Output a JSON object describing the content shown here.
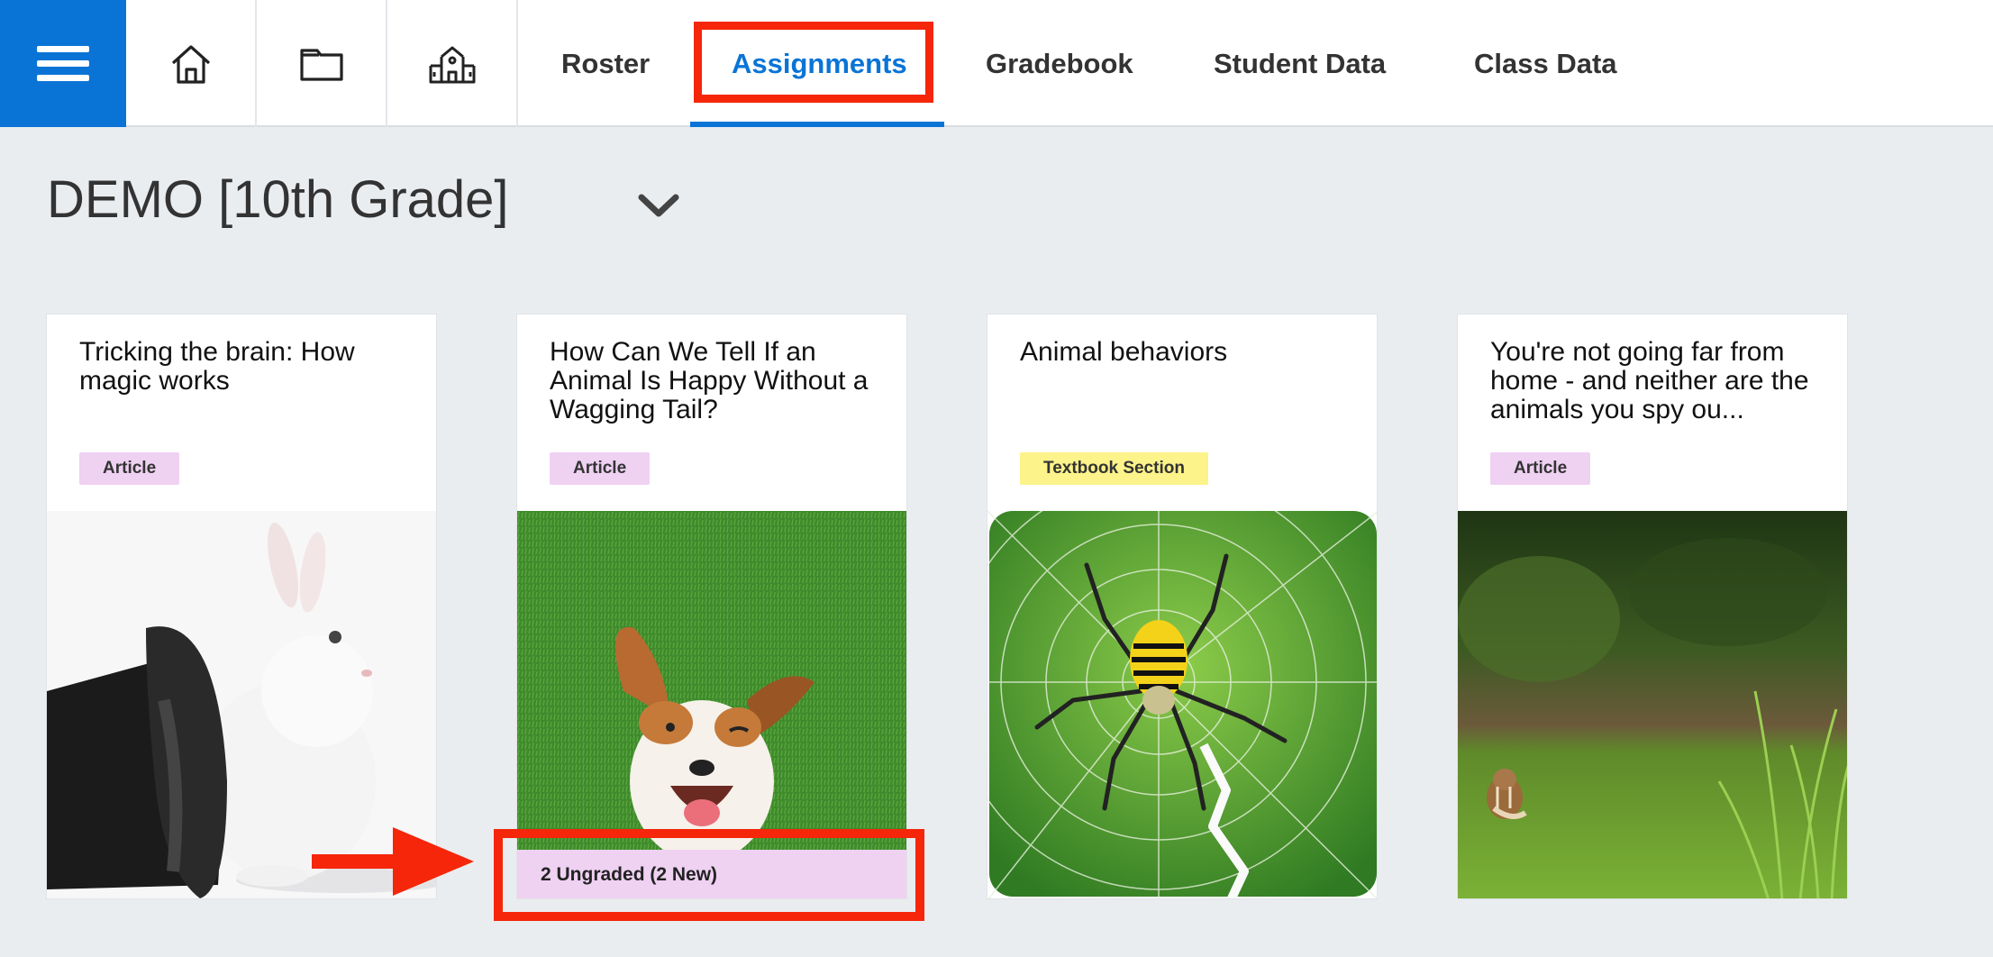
{
  "nav": {
    "menu_icon": "hamburger-icon",
    "icons": [
      "home-icon",
      "folder-icon",
      "school-icon"
    ],
    "tabs": [
      {
        "label": "Roster",
        "active": false
      },
      {
        "label": "Assignments",
        "active": true
      },
      {
        "label": "Gradebook",
        "active": false
      },
      {
        "label": "Student Data",
        "active": false
      },
      {
        "label": "Class Data",
        "active": false
      }
    ],
    "accent_color": "#0a74d6",
    "highlight_color": "#f5260a"
  },
  "class_selector": {
    "title": "DEMO [10th Grade]",
    "icon": "chevron-down-icon"
  },
  "cards": [
    {
      "title": "Tricking the brain: How magic works",
      "type": "Article",
      "image": "rabbit-in-hat-image"
    },
    {
      "title": "How Can We Tell If an Animal Is Happy Without a Wagging Tail?",
      "type": "Article",
      "image": "happy-dog-image",
      "status": "2 Ungraded (2 New)"
    },
    {
      "title": "Animal behaviors",
      "type": "Textbook Section",
      "image": "spider-web-image"
    },
    {
      "title": "You're not going far from home - and neither are the animals you spy ou...",
      "type": "Article",
      "image": "chipmunk-image"
    }
  ]
}
